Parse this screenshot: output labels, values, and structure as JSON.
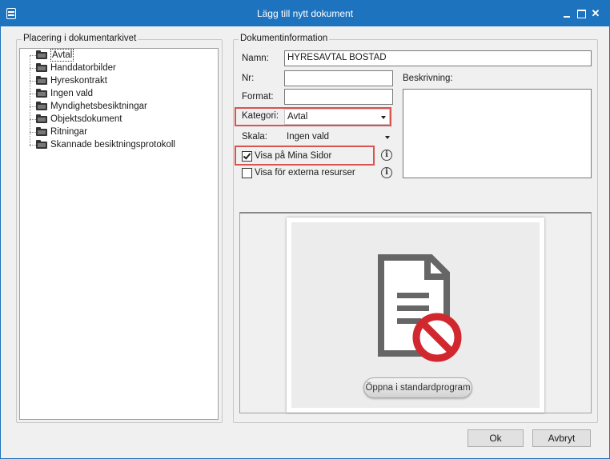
{
  "window": {
    "title": "Lägg till nytt dokument"
  },
  "archive": {
    "legend": "Placering i dokumentarkivet",
    "items": [
      {
        "label": "Avtal",
        "selected": true
      },
      {
        "label": "Handdatorbilder"
      },
      {
        "label": "Hyreskontrakt"
      },
      {
        "label": "Ingen vald"
      },
      {
        "label": "Myndighetsbesiktningar"
      },
      {
        "label": "Objektsdokument"
      },
      {
        "label": "Ritningar"
      },
      {
        "label": "Skannade besiktningsprotokoll"
      }
    ]
  },
  "info": {
    "legend": "Dokumentinformation",
    "name_label": "Namn:",
    "name_value": "HYRESAVTAL BOSTAD",
    "nr_label": "Nr:",
    "nr_value": "",
    "format_label": "Format:",
    "format_value": "",
    "description_label": "Beskrivning:",
    "description_value": "",
    "category_label": "Kategori:",
    "category_value": "Avtal",
    "scale_label": "Skala:",
    "scale_value": "Ingen vald",
    "show_mina_sidor_label": "Visa på Mina Sidor",
    "show_mina_sidor_checked": true,
    "show_external_label": "Visa för externa resurser",
    "show_external_checked": false
  },
  "preview": {
    "open_button_label": "Öppna i standardprogram"
  },
  "footer": {
    "ok_label": "Ok",
    "cancel_label": "Avbryt"
  },
  "colors": {
    "titlebar": "#1e73be",
    "highlight": "#d9534f",
    "no_sign": "#d0282e",
    "doc_icon": "#666666"
  }
}
